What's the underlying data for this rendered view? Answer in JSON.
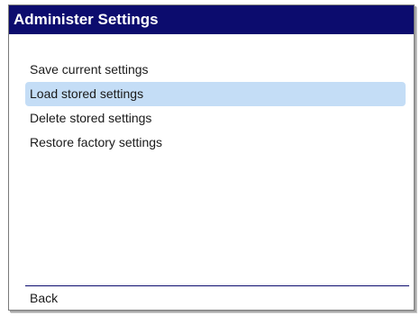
{
  "window": {
    "title": "Administer Settings"
  },
  "menu": {
    "items": [
      {
        "label": "Save current settings",
        "selected": false
      },
      {
        "label": "Load stored settings",
        "selected": true
      },
      {
        "label": "Delete stored settings",
        "selected": false
      },
      {
        "label": "Restore factory settings",
        "selected": false
      }
    ]
  },
  "footer": {
    "back_label": "Back"
  },
  "colors": {
    "title_background": "#0c0c6e",
    "selection_highlight": "#c4ddf6",
    "footer_rule": "#0c0c6e"
  }
}
